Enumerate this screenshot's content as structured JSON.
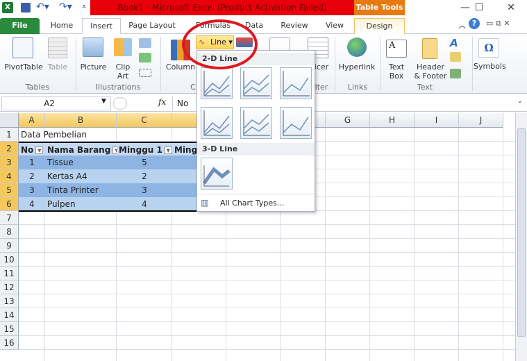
{
  "title": "Book1  -  Microsoft Excel (Product Activation Failed)",
  "contextual_tab": "Table Tools",
  "window_controls": {
    "minimize": "—",
    "maximize": "☐",
    "close": "✕"
  },
  "tabs": [
    "File",
    "Home",
    "Insert",
    "Page Layout",
    "Formulas",
    "Data",
    "Review",
    "View",
    "Design"
  ],
  "active_tab": "Insert",
  "ribbon": {
    "groups": {
      "tables": "Tables",
      "illustrations": "Illustrations",
      "charts": "C",
      "filter": "lter",
      "links": "Links",
      "text": "Text"
    },
    "pivottable": "PivotTable",
    "table": "Table",
    "picture": "Picture",
    "clipart1": "Clip",
    "clipart2": "Art",
    "column": "Column",
    "line": "Line",
    "slicer": "icer",
    "hyperlink": "Hyperlink",
    "textbox1": "Text",
    "textbox2": "Box",
    "header1": "Header",
    "header2": "& Footer",
    "symbols": "Symbols"
  },
  "formula_bar": {
    "name_box": "A2",
    "fx": "fx",
    "value": "No"
  },
  "columns": [
    "A",
    "B",
    "C",
    "D",
    "E",
    "F",
    "G",
    "H",
    "I",
    "J"
  ],
  "rows": [
    "1",
    "2",
    "3",
    "4",
    "5",
    "6",
    "7",
    "8",
    "9",
    "10",
    "11",
    "12",
    "13",
    "14",
    "15",
    "16"
  ],
  "sheet": {
    "title": "Data Pembelian",
    "headers": [
      "No",
      "Nama Barang",
      "Minggu 1",
      "Ming"
    ],
    "data": [
      [
        "1",
        "Tissue",
        "5"
      ],
      [
        "2",
        "Kertas A4",
        "2"
      ],
      [
        "3",
        "Tinta Printer",
        "3"
      ],
      [
        "4",
        "Pulpen",
        "4"
      ]
    ]
  },
  "dropdown": {
    "section_2d": "2-D Line",
    "section_3d": "3-D Line",
    "all_chart_types": "All Chart Types..."
  },
  "colors": {
    "title_red": "#e8000b",
    "table_tools": "#e87a12",
    "file_tab": "#2a8a3c",
    "highlight_ellipse": "#e2161e",
    "band_dark": "#8db4e2",
    "band_light": "#b8d3f0"
  }
}
